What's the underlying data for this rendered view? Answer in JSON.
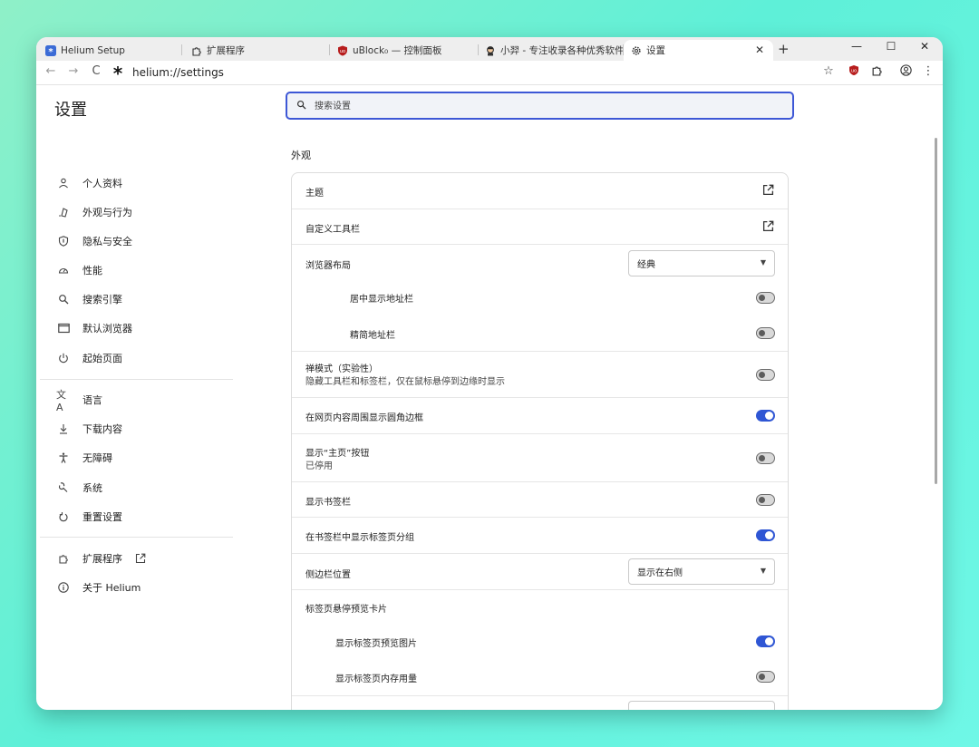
{
  "tabs": [
    {
      "title": "Helium Setup",
      "icon": "helium-logo-icon"
    },
    {
      "title": "扩展程序",
      "icon": "puzzle-icon"
    },
    {
      "title": "uBlock₀ — 控制面板",
      "icon": "ublock-icon"
    },
    {
      "title": "小羿 - 专注收录各种优秀软件",
      "icon": "avatar-icon"
    },
    {
      "title": "设置",
      "icon": "gear-icon",
      "active": true
    }
  ],
  "toolbar": {
    "url": "helium://settings"
  },
  "sidebar": {
    "title": "设置",
    "items": [
      {
        "label": "个人资料",
        "icon": "person-icon"
      },
      {
        "label": "外观与行为",
        "icon": "paint-icon"
      },
      {
        "label": "隐私与安全",
        "icon": "shield-icon"
      },
      {
        "label": "性能",
        "icon": "speedometer-icon"
      },
      {
        "label": "搜索引擎",
        "icon": "search-icon"
      },
      {
        "label": "默认浏览器",
        "icon": "browser-window-icon"
      },
      {
        "label": "起始页面",
        "icon": "power-icon"
      },
      {
        "label": "语言",
        "icon": "translate-icon"
      },
      {
        "label": "下载内容",
        "icon": "download-icon"
      },
      {
        "label": "无障碍",
        "icon": "accessibility-icon"
      },
      {
        "label": "系统",
        "icon": "wrench-icon"
      },
      {
        "label": "重置设置",
        "icon": "reset-icon"
      },
      {
        "label": "扩展程序",
        "icon": "puzzle-icon"
      },
      {
        "label": "关于 Helium",
        "icon": "info-icon"
      }
    ]
  },
  "search": {
    "placeholder": "搜索设置"
  },
  "section": {
    "title": "外观"
  },
  "settings": {
    "theme": "主题",
    "customize_toolbar": "自定义工具栏",
    "browser_layout": "浏览器布局",
    "browser_layout_value": "经典",
    "center_address_bar": "居中显示地址栏",
    "compact_address_bar": "精简地址栏",
    "zen_mode": "禅模式（实验性）",
    "zen_mode_desc": "隐藏工具栏和标签栏，仅在鼠标悬停到边缘时显示",
    "rounded_border": "在网页内容周围显示圆角边框",
    "show_home_button": "显示“主页”按钮",
    "show_home_button_desc": "已停用",
    "show_bookmarks_bar": "显示书签栏",
    "show_tab_groups_in_bookmarks": "在书签栏中显示标签页分组",
    "sidebar_position": "侧边栏位置",
    "sidebar_position_value": "显示在右侧",
    "tab_hover_card": "标签页悬停预览卡片",
    "show_tab_preview_image": "显示标签页预览图片",
    "show_tab_memory_usage": "显示标签页内存用量"
  },
  "toggles": {
    "center_address_bar": false,
    "compact_address_bar": false,
    "zen_mode": false,
    "rounded_border": true,
    "show_home_button": false,
    "show_bookmarks_bar": false,
    "show_tab_groups_in_bookmarks": true,
    "show_tab_preview_image": true,
    "show_tab_memory_usage": false
  },
  "colors": {
    "accent": "#2f56d4",
    "background_gradient_start": "#8ff0c8",
    "background_gradient_end": "#6ff7e6"
  }
}
